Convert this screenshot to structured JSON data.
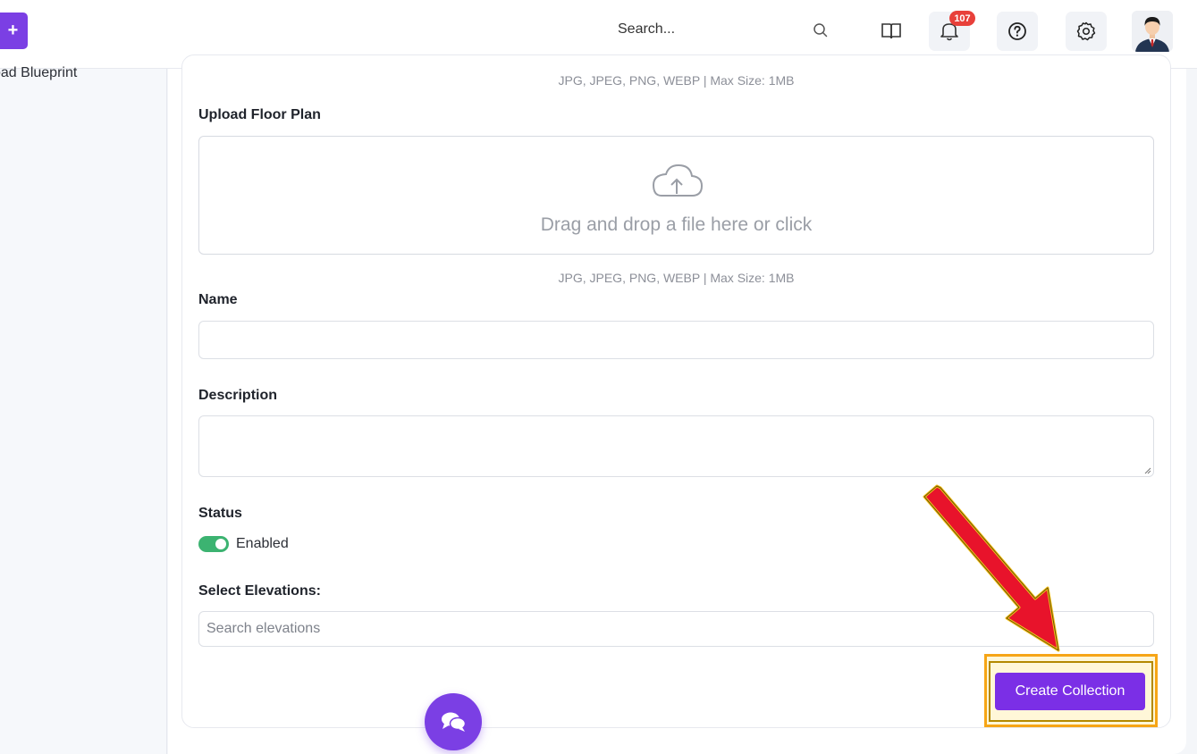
{
  "topbar": {
    "add_label": "+",
    "search_placeholder": "Search...",
    "notification_count": "107",
    "icons": [
      "search-icon",
      "book-icon",
      "bell-icon",
      "help-icon",
      "gear-icon",
      "user-avatar"
    ]
  },
  "sidebar": {
    "items": [
      {
        "label": "oad Blueprint"
      }
    ]
  },
  "form": {
    "top_hint": "JPG, JPEG, PNG, WEBP | Max Size: 1MB",
    "floor_plan_label": "Upload Floor Plan",
    "dropzone_text": "Drag and drop a file here or click",
    "floor_plan_hint": "JPG, JPEG, PNG, WEBP | Max Size: 1MB",
    "name_label": "Name",
    "name_value": "",
    "description_label": "Description",
    "description_value": "",
    "status_label": "Status",
    "status_toggle_label": "Enabled",
    "status_enabled": true,
    "elevations_label": "Select Elevations:",
    "elevations_placeholder": "Search elevations",
    "submit_label": "Create Collection"
  },
  "colors": {
    "primary": "#7b2fe6",
    "toggle_on": "#3cb371",
    "badge": "#e8403a",
    "annotation_arrow": "#e8132b",
    "annotation_outline": "#f6a516"
  }
}
